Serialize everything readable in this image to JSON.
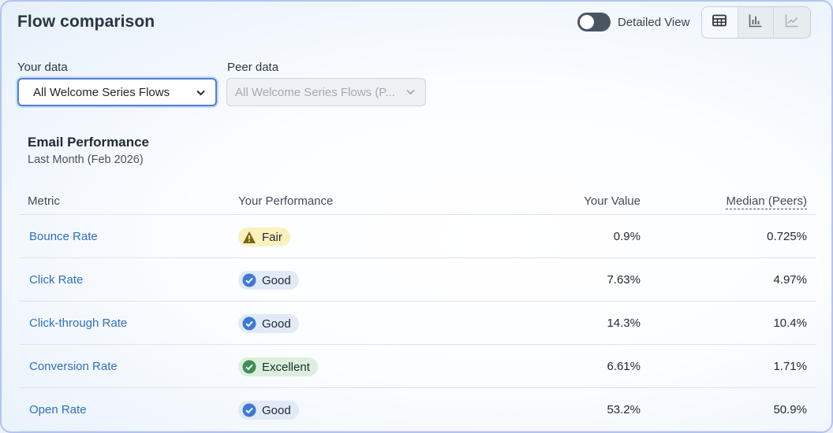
{
  "header": {
    "title": "Flow comparison",
    "toggle_label": "Detailed View",
    "toggle_on": false,
    "views": [
      {
        "icon": "table-icon",
        "active": true
      },
      {
        "icon": "bar-chart-icon",
        "active": false
      },
      {
        "icon": "line-chart-icon",
        "active": false
      }
    ]
  },
  "filters": {
    "your_data_label": "Your data",
    "your_data_value": "All Welcome Series Flows",
    "peer_data_label": "Peer data",
    "peer_data_value": "All Welcome Series Flows (P..."
  },
  "section": {
    "title": "Email Performance",
    "subtitle": "Last Month (Feb 2026)"
  },
  "table": {
    "headers": {
      "metric": "Metric",
      "performance": "Your Performance",
      "value": "Your Value",
      "median": "Median (Peers)"
    },
    "rows": [
      {
        "metric": "Bounce Rate",
        "status": "Fair",
        "status_type": "fair",
        "value": "0.9%",
        "median": "0.725%"
      },
      {
        "metric": "Click Rate",
        "status": "Good",
        "status_type": "good",
        "value": "7.63%",
        "median": "4.97%"
      },
      {
        "metric": "Click-through Rate",
        "status": "Good",
        "status_type": "good",
        "value": "14.3%",
        "median": "10.4%"
      },
      {
        "metric": "Conversion Rate",
        "status": "Excellent",
        "status_type": "excellent",
        "value": "6.61%",
        "median": "1.71%"
      },
      {
        "metric": "Open Rate",
        "status": "Good",
        "status_type": "good",
        "value": "53.2%",
        "median": "50.9%"
      }
    ]
  },
  "colors": {
    "link": "#2f6fc0",
    "fair": "#fbf1bd",
    "good": "#e1eaf6",
    "excellent": "#dcefdc",
    "good_icon": "#3f78d8",
    "excellent_icon": "#3f8f55",
    "fair_icon": "#7a6318"
  }
}
